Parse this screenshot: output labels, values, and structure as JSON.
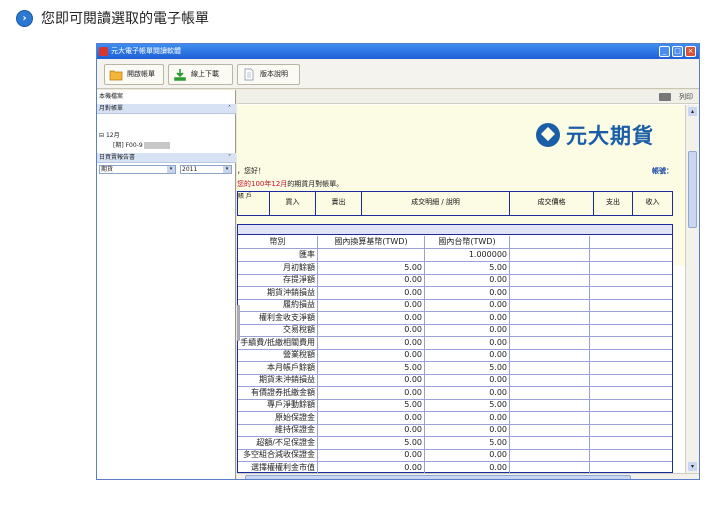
{
  "page": {
    "heading": "您即可閱讀選取的電子帳單",
    "heading_icon": "arrow-right-circle-icon"
  },
  "window": {
    "title": "元大電子帳單閱讀軟體",
    "toolbar": {
      "open": "開啟帳單",
      "download": "線上下載",
      "version": "版本說明"
    },
    "left": {
      "local_label": "本機檔案",
      "monthly_label": "月對帳單",
      "type_value": "期貨",
      "year_value": "2011",
      "tree_month": "12月",
      "tree_item": "[期] F00-9",
      "daily_label": "日買賣報告書"
    },
    "main": {
      "print_label": "列印",
      "logo_text": "元大期貨",
      "greeting": "，您好！",
      "account_label": "帳號：",
      "month_text_red": "您的100年12月",
      "month_text": "的期貨月對帳單。",
      "header_cols": [
        "賬\n戶",
        "買入",
        "賣出",
        "成交明細 / 說明",
        "成交價格",
        "支出",
        "收入"
      ],
      "table": {
        "headers": [
          "幣別",
          "國內換算基幣(TWD)",
          "國內台幣(TWD)",
          "",
          ""
        ],
        "rows": [
          [
            "匯率",
            "",
            "1.000000"
          ],
          [
            "月初餘額",
            "5.00",
            "5.00"
          ],
          [
            "存提淨額",
            "0.00",
            "0.00"
          ],
          [
            "期貨沖銷損益",
            "0.00",
            "0.00"
          ],
          [
            "履約損益",
            "0.00",
            "0.00"
          ],
          [
            "權利金收支淨額",
            "0.00",
            "0.00"
          ],
          [
            "交易稅額",
            "0.00",
            "0.00"
          ],
          [
            "手續費/抵繳相關費用",
            "0.00",
            "0.00"
          ],
          [
            "營業稅額",
            "0.00",
            "0.00"
          ],
          [
            "本月帳戶餘額",
            "5.00",
            "5.00"
          ],
          [
            "期貨未沖銷損益",
            "0.00",
            "0.00"
          ],
          [
            "有價證券抵繳金額",
            "0.00",
            "0.00"
          ],
          [
            "專戶淨動餘額",
            "5.00",
            "5.00"
          ],
          [
            "原始保證金",
            "0.00",
            "0.00"
          ],
          [
            "維持保證金",
            "0.00",
            "0.00"
          ],
          [
            "超額/不足保證金",
            "5.00",
            "5.00"
          ],
          [
            "多空組合減收保證金",
            "0.00",
            "0.00"
          ],
          [
            "選擇權權利金市值",
            "0.00",
            "0.00"
          ]
        ]
      }
    }
  }
}
